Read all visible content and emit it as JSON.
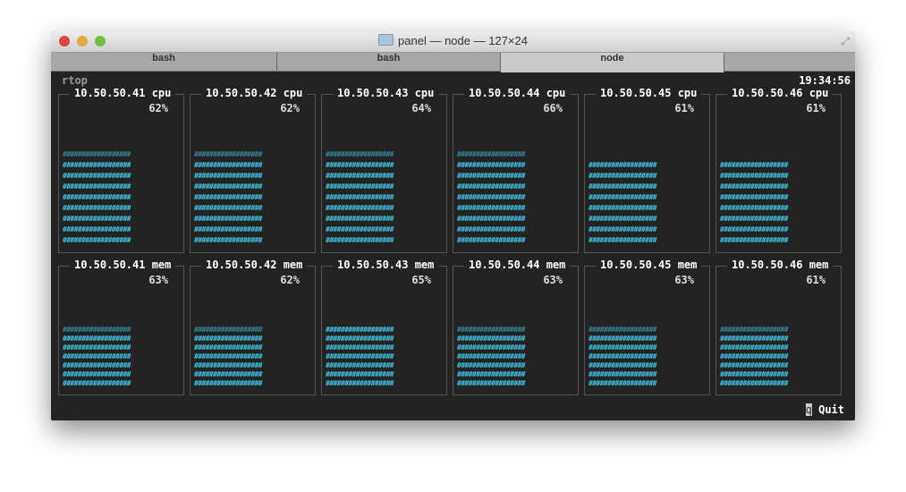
{
  "window": {
    "title": "panel — node — 127×24"
  },
  "tabs": [
    {
      "label": "bash"
    },
    {
      "label": "bash"
    },
    {
      "label": "node"
    }
  ],
  "app": {
    "name": "rtop",
    "clock": "19:34:56",
    "quit_key": "q",
    "quit_label": "Quit"
  },
  "colors": {
    "bar": "#41c6e6",
    "background": "#232323"
  },
  "chart_data": [
    {
      "type": "bar",
      "title": "cpu",
      "series": [
        {
          "name": "10.50.50.41 cpu",
          "value": 62,
          "label": "62%"
        },
        {
          "name": "10.50.50.42 cpu",
          "value": 62,
          "label": "62%"
        },
        {
          "name": "10.50.50.43 cpu",
          "value": 64,
          "label": "64%"
        },
        {
          "name": "10.50.50.44 cpu",
          "value": 66,
          "label": "66%"
        },
        {
          "name": "10.50.50.45 cpu",
          "value": 61,
          "label": "61%"
        },
        {
          "name": "10.50.50.46 cpu",
          "value": 61,
          "label": "61%"
        }
      ]
    },
    {
      "type": "bar",
      "title": "mem",
      "series": [
        {
          "name": "10.50.50.41 mem",
          "value": 63,
          "label": "63%"
        },
        {
          "name": "10.50.50.42 mem",
          "value": 62,
          "label": "62%"
        },
        {
          "name": "10.50.50.43 mem",
          "value": 65,
          "label": "65%"
        },
        {
          "name": "10.50.50.44 mem",
          "value": 63,
          "label": "63%"
        },
        {
          "name": "10.50.50.45 mem",
          "value": 63,
          "label": "63%"
        },
        {
          "name": "10.50.50.46 mem",
          "value": 61,
          "label": "61%"
        }
      ]
    }
  ]
}
